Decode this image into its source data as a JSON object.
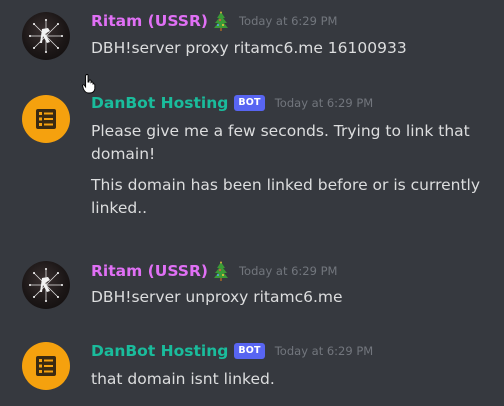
{
  "colors": {
    "background": "#36393f",
    "user_name": "#e070f5",
    "bot_name": "#1abc9c",
    "bot_tag_bg": "#5865f2",
    "timestamp": "#72767d",
    "text": "#dcddde",
    "bot_avatar_bg": "#f5a10e"
  },
  "messages": [
    {
      "author": "Ritam (USSR)",
      "avatar_icon": "firework-avatar",
      "decoration_icon": "christmas-tree-icon",
      "timestamp": "Today at 6:29 PM",
      "lines": [
        "DBH!server proxy ritamc6.me 16100933"
      ]
    },
    {
      "author": "DanBot Hosting",
      "avatar_icon": "server-rack-icon",
      "tag": "BOT",
      "timestamp": "Today at 6:29 PM",
      "lines": [
        "Please give me a few seconds. Trying to link that domain!",
        "This domain has been linked before or is currently linked.."
      ]
    },
    {
      "author": "Ritam (USSR)",
      "avatar_icon": "firework-avatar",
      "decoration_icon": "christmas-tree-icon",
      "timestamp": "Today at 6:29 PM",
      "lines": [
        "DBH!server unproxy ritamc6.me"
      ]
    },
    {
      "author": "DanBot Hosting",
      "avatar_icon": "server-rack-icon",
      "tag": "BOT",
      "timestamp": "Today at 6:29 PM",
      "lines": [
        "that domain isnt linked."
      ]
    }
  ]
}
